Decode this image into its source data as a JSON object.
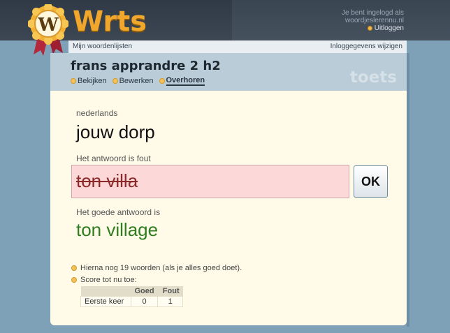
{
  "header": {
    "logo_text": "Wrts",
    "logo_badge_letter": "W",
    "login_line1": "Je bent ingelogd als",
    "login_line2": "woordjeslerennu.nl",
    "logout_label": "Uitloggen"
  },
  "navbar": {
    "left_link": "Mijn woordenlijsten",
    "right_link": "Inloggegevens wijzigen"
  },
  "list": {
    "title": "frans apprandre 2 h2",
    "mode_label": "toets",
    "tabs": [
      {
        "label": "Bekijken",
        "active": false
      },
      {
        "label": "Bewerken",
        "active": false
      },
      {
        "label": "Overhoren",
        "active": true
      }
    ]
  },
  "quiz": {
    "language_label": "nederlands",
    "question": "jouw dorp",
    "wrong_label": "Het antwoord is fout",
    "given_answer": "ton villa",
    "ok_button": "OK",
    "correct_label": "Het goede antwoord is",
    "correct_answer": "ton village"
  },
  "progress": {
    "remaining_text": "Hierna nog 19 woorden (als je alles goed doet).",
    "score_label": "Score tot nu toe:",
    "table": {
      "headers": [
        "",
        "Goed",
        "Fout"
      ],
      "rows": [
        {
          "label": "Eerste keer",
          "goed": "0",
          "fout": "1"
        }
      ]
    }
  },
  "colors": {
    "accent": "#f0a72c",
    "wrong_bg": "#fdd8d9",
    "correct_text": "#2e7d20"
  }
}
